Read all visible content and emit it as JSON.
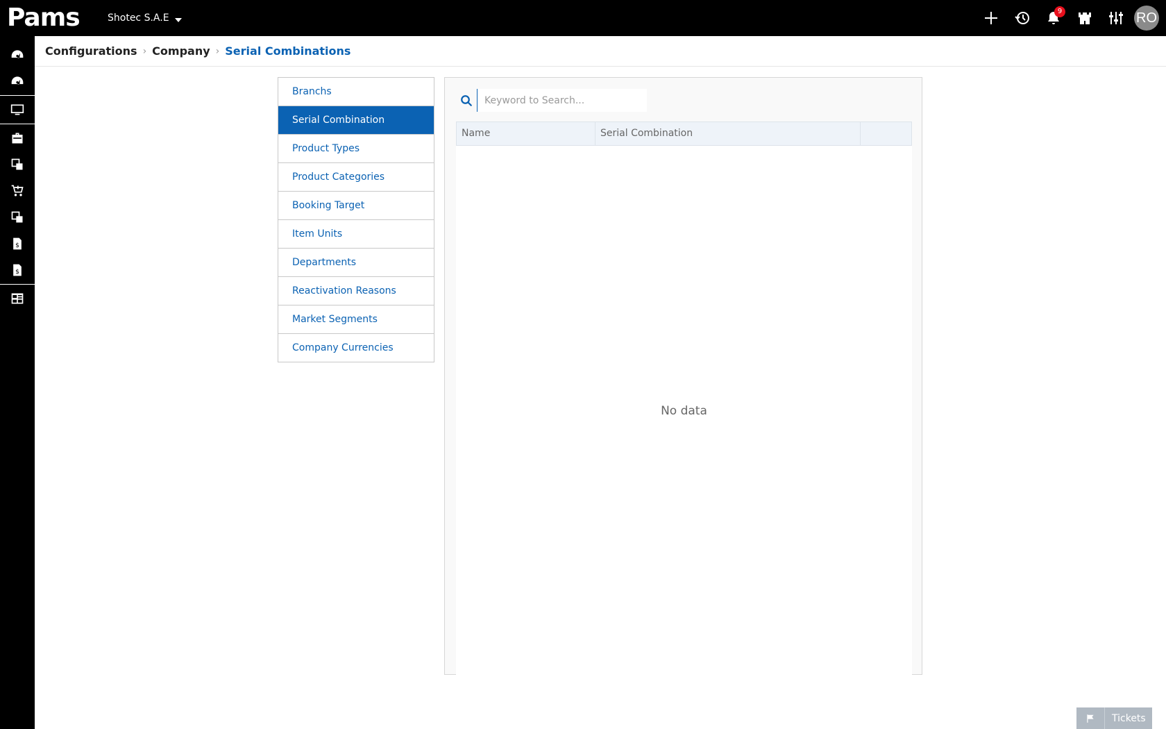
{
  "app": {
    "logo_text": "Pams",
    "company": "Shotec S.A.E"
  },
  "topbar": {
    "actions": [
      {
        "name": "add-icon"
      },
      {
        "name": "history-icon"
      },
      {
        "name": "bell-icon",
        "badge": "9"
      },
      {
        "name": "castle-icon"
      },
      {
        "name": "sliders-icon"
      }
    ],
    "avatar": "RO"
  },
  "sidebar": {
    "items": [
      "dashboard-icon",
      "dashboard-icon",
      "monitor-icon",
      "briefcase-icon",
      "stock-icon",
      "cart-icon",
      "stock-icon",
      "invoice-icon",
      "invoice-icon",
      "report-icon"
    ]
  },
  "breadcrumb": {
    "items": [
      "Configurations",
      "Company",
      "Serial Combinations"
    ]
  },
  "config_menu": {
    "items": [
      "Branchs",
      "Serial Combination",
      "Product Types",
      "Product Categories",
      "Booking Target",
      "Item Units",
      "Departments",
      "Reactivation Reasons",
      "Market Segments",
      "Company Currencies"
    ],
    "active_index": 1
  },
  "search": {
    "placeholder": "Keyword to Search...",
    "value": ""
  },
  "table": {
    "columns": [
      "Name",
      "Serial Combination",
      ""
    ],
    "empty_text": "No data"
  },
  "tickets": {
    "label": "Tickets"
  },
  "colors": {
    "accent": "#0b62b3",
    "badge": "#e8101d",
    "topbar": "#000000"
  }
}
